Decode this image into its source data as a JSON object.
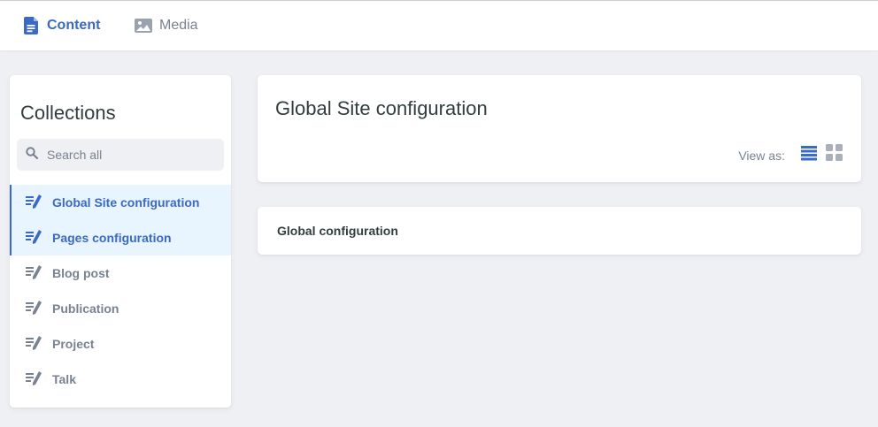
{
  "header": {
    "tabs": [
      {
        "label": "Content",
        "icon": "document-icon",
        "active": true
      },
      {
        "label": "Media",
        "icon": "image-icon",
        "active": false
      }
    ]
  },
  "sidebar": {
    "title": "Collections",
    "search": {
      "placeholder": "Search all",
      "value": "",
      "icon": "search-icon"
    },
    "items": [
      {
        "label": "Global Site configuration",
        "icon": "write-icon",
        "active": true
      },
      {
        "label": "Pages configuration",
        "icon": "write-icon",
        "active": true
      },
      {
        "label": "Blog post",
        "icon": "write-icon",
        "active": false
      },
      {
        "label": "Publication",
        "icon": "write-icon",
        "active": false
      },
      {
        "label": "Project",
        "icon": "write-icon",
        "active": false
      },
      {
        "label": "Talk",
        "icon": "write-icon",
        "active": false
      }
    ]
  },
  "main": {
    "title": "Global Site configuration",
    "view_as_label": "View as:",
    "view_modes": [
      {
        "name": "list",
        "icon": "list-view-icon",
        "selected": true
      },
      {
        "name": "grid",
        "icon": "grid-view-icon",
        "selected": false
      }
    ],
    "entries": [
      {
        "title": "Global configuration"
      }
    ]
  },
  "colors": {
    "accent": "#3a69c7",
    "muted": "#798291",
    "background": "#eff0f4",
    "active_item_bg": "#e8f5fe",
    "text": "#313d3e"
  }
}
